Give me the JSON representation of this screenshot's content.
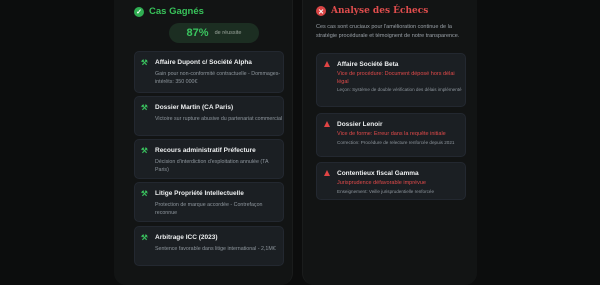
{
  "left": {
    "title": "Cas Gagnés",
    "rate_value": "87%",
    "rate_label": "de réussite",
    "cases": [
      {
        "title": "Affaire Dupont c/ Société Alpha",
        "desc": "Gain pour non-conformité contractuelle - Dommages-intérêts: 350 000€"
      },
      {
        "title": "Dossier Martin (CA Paris)",
        "desc": "Victoire sur rupture abusive du partenariat commercial"
      },
      {
        "title": "Recours administratif Préfecture",
        "desc": "Décision d'interdiction d'exploitation annulée (TA Paris)"
      },
      {
        "title": "Litige Propriété Intellectuelle",
        "desc": "Protection de marque accordée - Contrefaçon reconnue"
      },
      {
        "title": "Arbitrage ICC (2023)",
        "desc": "Sentence favorable dans litige international - 2,1M€"
      }
    ]
  },
  "right": {
    "title": "Analyse des Échecs",
    "intro": "Ces cas sont cruciaux pour l'amélioration continue de la stratégie procédurale et témoignent de notre transparence.",
    "cases": [
      {
        "title": "Affaire Société Beta",
        "cause": "Vice de procédure: Document déposé hors délai légal",
        "note": "Leçon: Système de double vérification des délais implémenté"
      },
      {
        "title": "Dossier Lenoir",
        "cause": "Vice de forme: Erreur dans la requête initiale",
        "note": "Correction: Procédure de relecture renforcée depuis 2021"
      },
      {
        "title": "Contentieux fiscal Gamma",
        "cause": "Jurisprudence défavorable imprévue",
        "note": "Enseignement: Veille jurisprudentielle renforcée"
      }
    ]
  }
}
